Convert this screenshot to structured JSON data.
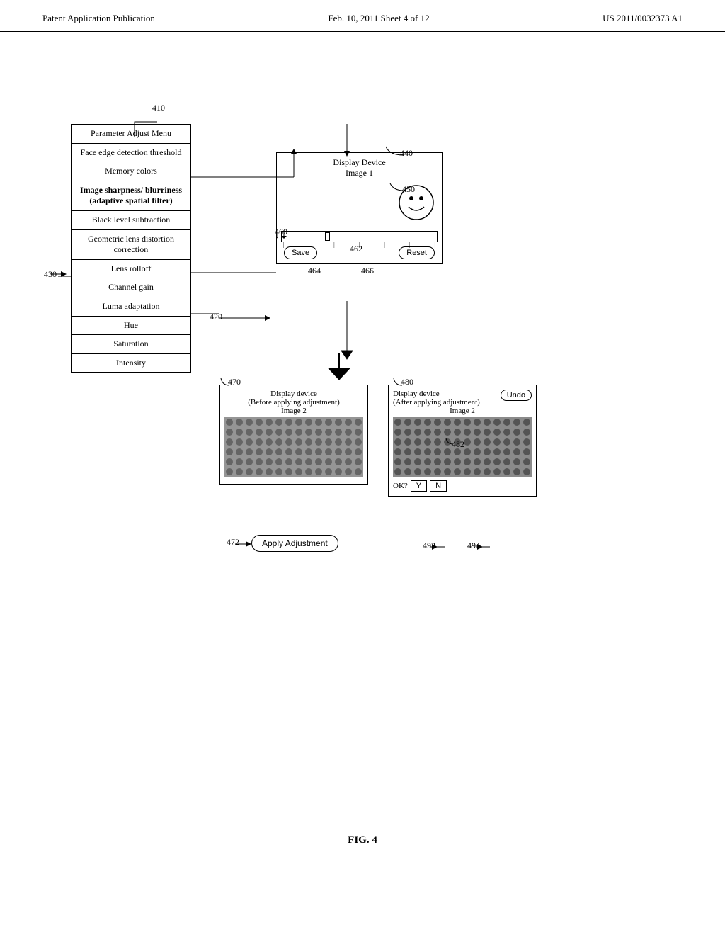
{
  "header": {
    "left": "Patent Application Publication",
    "center": "Feb. 10, 2011   Sheet 4 of 12",
    "right": "US 2011/0032373 A1"
  },
  "diagram": {
    "label_410": "410",
    "label_420": "420",
    "label_430": "430",
    "label_440": "440",
    "label_450": "450",
    "label_460": "460",
    "label_462": "462",
    "label_464": "464",
    "label_466": "466",
    "label_470": "470",
    "label_472": "472",
    "label_480": "480",
    "label_482": "482",
    "label_492": "492",
    "label_494": "494",
    "param_menu": {
      "title": "Parameter Adjust Menu",
      "items": [
        {
          "text": "Face edge detection threshold",
          "bold": false
        },
        {
          "text": "Memory colors",
          "bold": false
        },
        {
          "text": "Image sharpness/ blurriness (adaptive spatial filter)",
          "bold": true
        },
        {
          "text": "Black level subtraction",
          "bold": false
        },
        {
          "text": "Geometric lens distortion correction",
          "bold": false
        },
        {
          "text": "Lens rolloff",
          "bold": false
        },
        {
          "text": "Channel gain",
          "bold": false
        },
        {
          "text": "Luma adaptation",
          "bold": false
        },
        {
          "text": "Hue",
          "bold": false
        },
        {
          "text": "Saturation",
          "bold": false
        },
        {
          "text": "Intensity",
          "bold": false
        }
      ]
    },
    "display_device_top": {
      "title": "Display Device",
      "subtitle": "Image 1",
      "save_label": "Save",
      "reset_label": "Reset"
    },
    "display_device_before": {
      "title": "Display device",
      "subtitle": "(Before applying adjustment)",
      "image_label": "Image 2",
      "apply_label": "Apply Adjustment"
    },
    "display_device_after": {
      "title": "Display device",
      "subtitle": "(After applying adjustment)",
      "image_label": "Image 2",
      "undo_label": "Undo",
      "ok_label": "OK?",
      "y_label": "Y",
      "n_label": "N"
    }
  },
  "fig_label": "FIG. 4"
}
